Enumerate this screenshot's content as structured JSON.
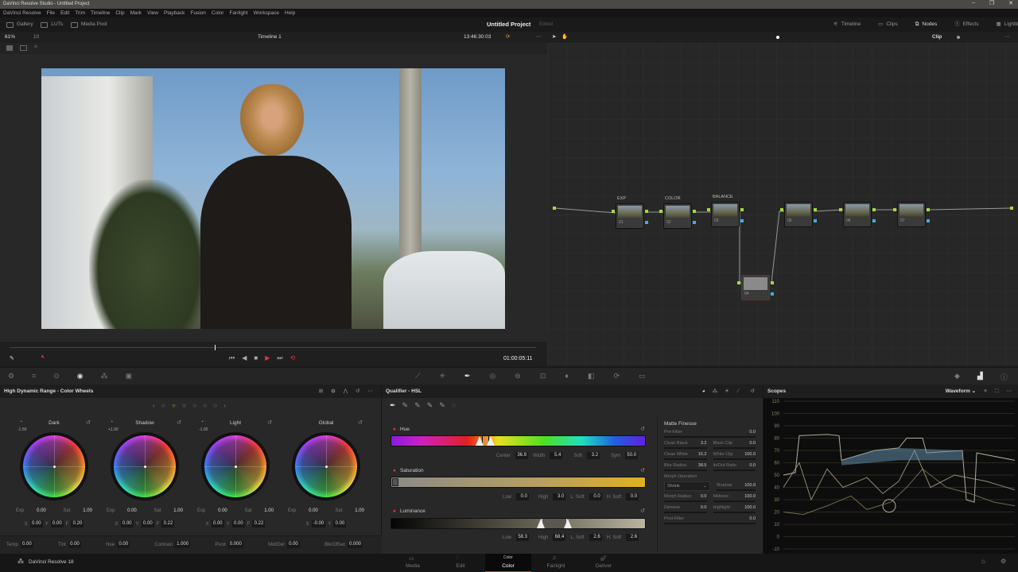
{
  "window": {
    "title": "DaVinci Resolve Studio - Untitled Project",
    "controls": [
      "–",
      "❐",
      "✕"
    ]
  },
  "menu": [
    "DaVinci Resolve",
    "File",
    "Edit",
    "Trim",
    "Timeline",
    "Clip",
    "Mark",
    "View",
    "Playback",
    "Fusion",
    "Color",
    "Fairlight",
    "Workspace",
    "Help"
  ],
  "toolbar": {
    "left": [
      "Gallery",
      "LUTs",
      "Media Pool"
    ],
    "project_title": "Untitled Project",
    "project_status": "Edited",
    "right": [
      "Timeline",
      "Clips",
      "Nodes",
      "Effects",
      "Lightbox"
    ]
  },
  "viewer": {
    "zoom": "61%",
    "frame": "10",
    "timeline": "Timeline 1",
    "timecode": "13:46:30:03",
    "playhead_timecode": "01:00:05:11",
    "scrub_position": 0.39
  },
  "node_editor": {
    "mode": "Clip",
    "nodes": [
      {
        "id": "01",
        "label": "EXP"
      },
      {
        "id": "02",
        "label": "COLOR"
      },
      {
        "id": "03",
        "label": "BALANCE"
      },
      {
        "id": "04",
        "label": ""
      },
      {
        "id": "05",
        "label": ""
      },
      {
        "id": "06",
        "label": ""
      },
      {
        "id": "07",
        "label": ""
      }
    ]
  },
  "wheels": {
    "title": "High Dynamic Range - Color Wheels",
    "items": [
      {
        "name": "Dark",
        "zone": "-1.50",
        "exp": "0.00",
        "sat": "1.00",
        "x": "0.00",
        "y": "0.00",
        "f": "0.20"
      },
      {
        "name": "Shadow",
        "zone": "+1.00",
        "exp": "0.00",
        "sat": "1.00",
        "x": "0.00",
        "y": "0.00",
        "f": "0.22"
      },
      {
        "name": "Light",
        "zone": "-1.00",
        "exp": "0.00",
        "sat": "1.00",
        "x": "0.00",
        "y": "0.00",
        "f": "0.22"
      },
      {
        "name": "Global",
        "zone": "",
        "exp": "0.00",
        "sat": "1.00",
        "x": "-0.00",
        "y": "0.00",
        "f": ""
      }
    ],
    "labels": {
      "exp": "Exp",
      "sat": "Sat",
      "x": "X",
      "y": "Y",
      "f": "F"
    },
    "bottom": [
      {
        "label": "Temp",
        "value": "0.00"
      },
      {
        "label": "Tint",
        "value": "0.00"
      },
      {
        "label": "Hue",
        "value": "0.00"
      },
      {
        "label": "Contrast",
        "value": "1.000"
      },
      {
        "label": "Pivot",
        "value": "0.000"
      },
      {
        "label": "Mid/Det",
        "value": "0.00"
      },
      {
        "label": "Blk/Offset",
        "value": "0.000"
      }
    ]
  },
  "qualifier": {
    "title": "Qualifier - HSL",
    "hue": {
      "label": "Hue",
      "center_label": "Center",
      "center": "36.9",
      "width_label": "Width",
      "width": "5.4",
      "soft_label": "Soft",
      "soft": "3.2",
      "sym_label": "Sym",
      "sym": "50.0"
    },
    "saturation": {
      "label": "Saturation",
      "low_label": "Low",
      "low": "0.0",
      "high_label": "High",
      "high": "3.0",
      "lsoft_label": "L. Soft",
      "lsoft": "0.0",
      "hsoft_label": "H. Soft",
      "hsoft": "0.0"
    },
    "luminance": {
      "label": "Luminance",
      "low_label": "Low",
      "low": "58.3",
      "high_label": "High",
      "high": "68.4",
      "lsoft_label": "L. Soft",
      "lsoft": "2.6",
      "hsoft_label": "H. Soft",
      "hsoft": "2.6"
    }
  },
  "matte": {
    "title": "Matte Finesse",
    "prefilter": {
      "label": "Pre-Filter",
      "value": "0.0"
    },
    "clean_black": {
      "label": "Clean Black",
      "value": "3.2"
    },
    "black_clip": {
      "label": "Black Clip",
      "value": "0.0"
    },
    "clean_white": {
      "label": "Clean White",
      "value": "16.2"
    },
    "white_clip": {
      "label": "White Clip",
      "value": "100.0"
    },
    "blur_radius": {
      "label": "Blur Radius",
      "value": "38.5"
    },
    "inout_ratio": {
      "label": "In/Out Ratio",
      "value": "0.0"
    },
    "morph_op_label": "Morph Operation",
    "morph_op": "Shrink",
    "shadow": {
      "label": "Shadow",
      "value": "100.0"
    },
    "morph_radius": {
      "label": "Morph Radius",
      "value": "0.0"
    },
    "midtone": {
      "label": "Midtone",
      "value": "100.0"
    },
    "denoise": {
      "label": "Denoise",
      "value": "0.0"
    },
    "highlight": {
      "label": "Highlight",
      "value": "100.0"
    },
    "postfilter": {
      "label": "Post-Filter",
      "value": "0.0"
    }
  },
  "scopes": {
    "title": "Scopes",
    "mode": "Waveform",
    "ticks": [
      "110",
      "100",
      "90",
      "80",
      "70",
      "60",
      "50",
      "40",
      "30",
      "20",
      "10",
      "0",
      "-10"
    ]
  },
  "pages": [
    "Media",
    "Edit",
    "Color",
    "Fairlight",
    "Deliver"
  ],
  "active_page": "Color",
  "app": {
    "name": "DaVinci Resolve 18"
  },
  "colors": {
    "accent": "#e03a3a",
    "node_green": "#a8d83a",
    "node_blue": "#3ab0e0"
  }
}
